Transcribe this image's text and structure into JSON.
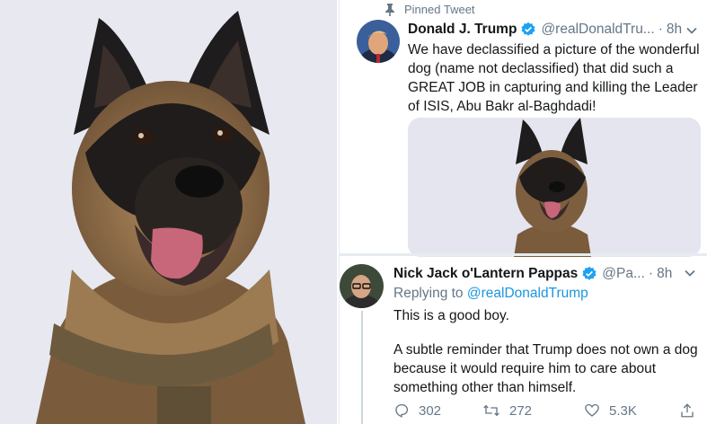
{
  "pinned_label": "Pinned Tweet",
  "tweet1": {
    "name": "Donald J. Trump",
    "handle": "@realDonaldTru...",
    "dot": "·",
    "time": "8h",
    "text": "We have declassified a picture of the wonderful dog (name not declassified) that did such a GREAT JOB in capturing and killing the Leader of ISIS, Abu Bakr al-Baghdadi!"
  },
  "tweet2": {
    "name": "Nick Jack o'Lantern Pappas",
    "handle": "@Pa...",
    "dot": "·",
    "time": "8h",
    "replying_prefix": "Replying to",
    "replying_mention": "@realDonaldTrump",
    "paragraph1": "This is a good boy.",
    "paragraph2": "A subtle reminder that Trump does not own a dog because it would require him to care about something other than himself.",
    "reply_count": "302",
    "retweet_count": "272",
    "like_count": "5.3K"
  },
  "colors": {
    "accent": "#1da1f2",
    "link": "#1b95e0",
    "muted": "#657786",
    "text": "#14171a",
    "photo_background": "#e7e8f0"
  },
  "icons": [
    "pin-icon",
    "verified-badge-icon",
    "chevron-down-icon",
    "reply-icon",
    "retweet-icon",
    "like-icon",
    "share-icon"
  ]
}
